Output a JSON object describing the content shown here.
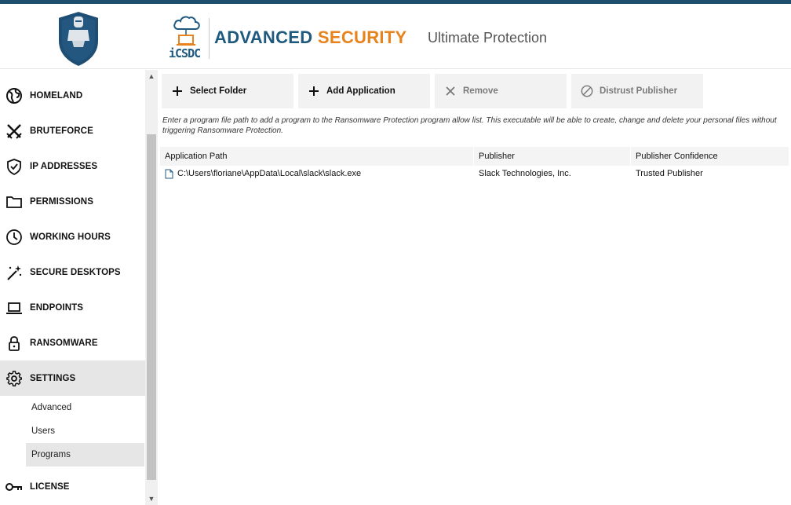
{
  "brand": {
    "logo_text": "iCSDC",
    "title_part1": "ADVANCED",
    "title_part2": "SECURITY",
    "subtitle": "Ultimate Protection",
    "colors": {
      "blue": "#1f5a7e",
      "orange": "#e8821c",
      "topbar": "#1d4e6e"
    }
  },
  "sidebar": {
    "items": [
      {
        "label": "HOMELAND",
        "icon": "globe-icon"
      },
      {
        "label": "BRUTEFORCE",
        "icon": "crossed-swords-icon"
      },
      {
        "label": "IP ADDRESSES",
        "icon": "shield-check-icon"
      },
      {
        "label": "PERMISSIONS",
        "icon": "folder-icon"
      },
      {
        "label": "WORKING HOURS",
        "icon": "clock-icon"
      },
      {
        "label": "SECURE DESKTOPS",
        "icon": "magic-wand-icon"
      },
      {
        "label": "ENDPOINTS",
        "icon": "laptop-icon"
      },
      {
        "label": "RANSOMWARE",
        "icon": "lock-icon"
      },
      {
        "label": "SETTINGS",
        "icon": "gear-icon",
        "active": true
      },
      {
        "label": "LICENSE",
        "icon": "key-icon"
      }
    ],
    "settings_sub": [
      {
        "label": "Advanced"
      },
      {
        "label": "Users"
      },
      {
        "label": "Programs",
        "active": true
      }
    ]
  },
  "toolbar": {
    "select_folder": "Select Folder",
    "add_application": "Add Application",
    "remove": "Remove",
    "distrust_publisher": "Distrust Publisher"
  },
  "hint": "Enter a program file path to add a program to the Ransomware Protection program allow list. This executable will be able to create, change and delete your personal files without triggering Ransomware Protection.",
  "table": {
    "columns": [
      "Application Path",
      "Publisher",
      "Publisher Confidence"
    ],
    "rows": [
      {
        "path": "C:\\Users\\floriane\\AppData\\Local\\slack\\slack.exe",
        "publisher": "Slack Technologies, Inc.",
        "confidence": "Trusted Publisher"
      }
    ]
  }
}
